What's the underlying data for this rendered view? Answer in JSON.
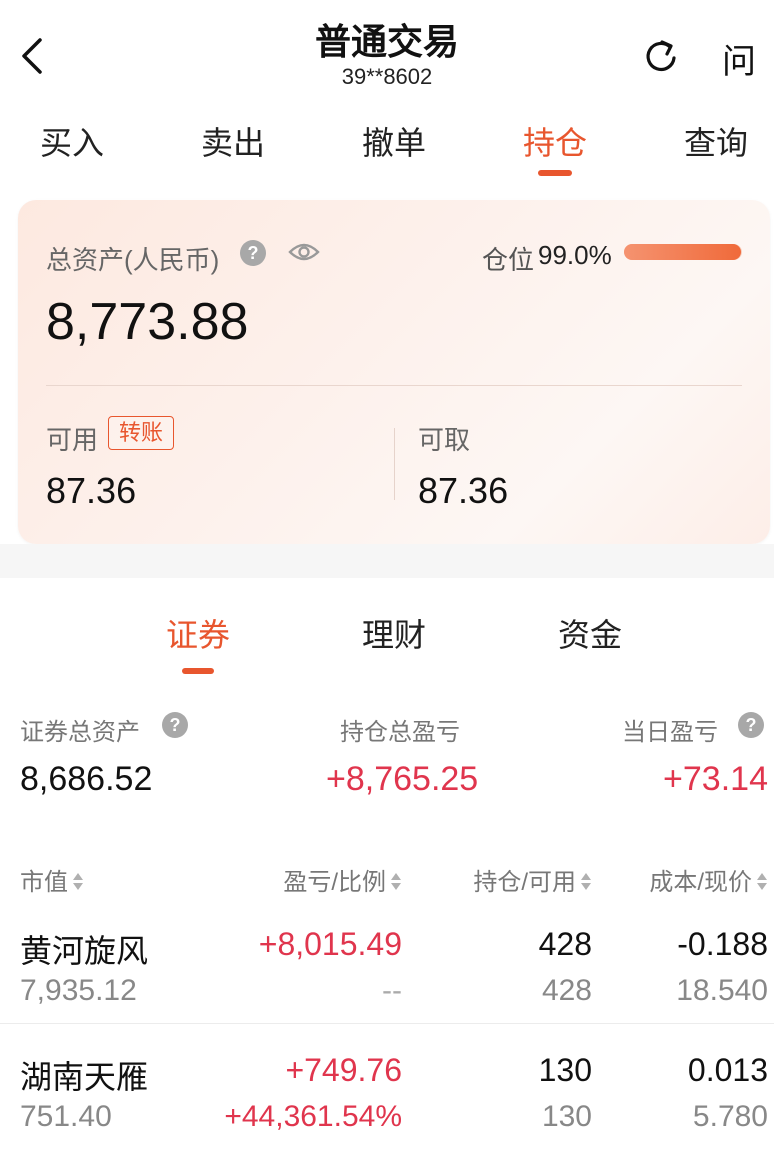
{
  "header": {
    "title": "普通交易",
    "account": "39**8602",
    "help_label": "问"
  },
  "tabs": [
    {
      "label": "买入",
      "active": false
    },
    {
      "label": "卖出",
      "active": false
    },
    {
      "label": "撤单",
      "active": false
    },
    {
      "label": "持仓",
      "active": true
    },
    {
      "label": "查询",
      "active": false
    }
  ],
  "assets": {
    "total_label": "总资产(人民币)",
    "total_value": "8,773.88",
    "position_label": "仓位",
    "position_value": "99.0%",
    "position_ratio": 0.99,
    "available_label": "可用",
    "transfer_label": "转账",
    "available_value": "87.36",
    "withdrawable_label": "可取",
    "withdrawable_value": "87.36"
  },
  "subtabs": [
    {
      "label": "证券",
      "active": true
    },
    {
      "label": "理财",
      "active": false
    },
    {
      "label": "资金",
      "active": false
    }
  ],
  "summary": {
    "securities_total_label": "证券总资产",
    "securities_total_value": "8,686.52",
    "holding_pl_label": "持仓总盈亏",
    "holding_pl_value": "+8,765.25",
    "daily_pl_label": "当日盈亏",
    "daily_pl_value": "+73.14"
  },
  "table": {
    "columns": [
      "市值",
      "盈亏/比例",
      "持仓/可用",
      "成本/现价"
    ],
    "rows": [
      {
        "name": "黄河旋风",
        "market_value": "7,935.12",
        "pl": "+8,015.49",
        "ratio": "--",
        "holding": "428",
        "available": "428",
        "cost": "-0.188",
        "price": "18.540"
      },
      {
        "name": "湖南天雁",
        "market_value": "751.40",
        "pl": "+749.76",
        "ratio": "+44,361.54%",
        "holding": "130",
        "available": "130",
        "cost": "0.013",
        "price": "5.780"
      }
    ]
  },
  "colors": {
    "accent": "#e8562e",
    "gain": "#e0354d",
    "muted": "#888888"
  },
  "icons": [
    "back-arrow-icon",
    "refresh-icon",
    "question-icon",
    "eye-icon",
    "sort-icon"
  ]
}
